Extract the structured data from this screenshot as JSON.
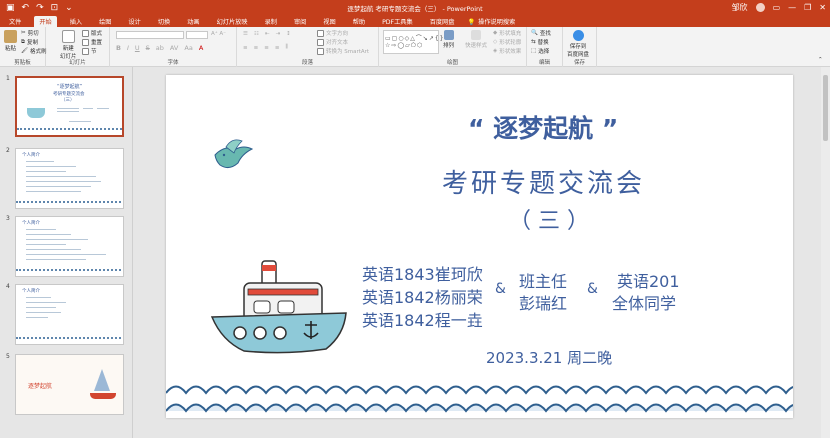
{
  "title_bar": {
    "title": "逐梦起航 考研专题交流会（三） - PowerPoint",
    "user_name": "邹欣",
    "undo": "↶",
    "redo": "↷",
    "present": "⊡",
    "minimize": "—",
    "restore": "❐",
    "close": "✕"
  },
  "tabs": [
    "文件",
    "开始",
    "插入",
    "绘图",
    "设计",
    "切换",
    "动画",
    "幻灯片放映",
    "录制",
    "审阅",
    "视图",
    "帮助",
    "PDF工具集",
    "百度网盘"
  ],
  "active_tab": "开始",
  "search_label": "操作说明搜索",
  "ribbon": {
    "clipboard": {
      "paste": "粘贴",
      "cut": "剪切",
      "copy": "复制",
      "format_painter": "格式刷",
      "label": "剪贴板"
    },
    "slides": {
      "new_slide": "新建\n幻灯片",
      "layout": "版式",
      "reset": "重置",
      "section": "节",
      "label": "幻灯片"
    },
    "font": {
      "bold": "B",
      "italic": "I",
      "underline": "U",
      "strike": "S",
      "shadow": "ab",
      "label": "字体"
    },
    "paragraph": {
      "text_direction": "文字方向",
      "align_text": "对齐文本",
      "smartart": "转换为 SmartArt",
      "label": "段落"
    },
    "drawing": {
      "arrange": "排列",
      "quick_styles": "快速样式",
      "fill": "形状填充",
      "outline": "形状轮廓",
      "effects": "形状效果",
      "label": "绘图"
    },
    "editing": {
      "find": "查找",
      "replace": "替换",
      "select": "选择",
      "label": "编辑"
    },
    "save": {
      "button": "保存到\n百度网盘",
      "label": "保存"
    }
  },
  "thumbnails": [
    {
      "num": "1",
      "title": "“逐梦起航”",
      "subtitle": "考研专题交流会",
      "part": "（三）"
    },
    {
      "num": "2",
      "title": "个人简介"
    },
    {
      "num": "3",
      "title": "个人简介"
    },
    {
      "num": "4",
      "title": "个人简介"
    },
    {
      "num": "5",
      "title": "逐梦起航"
    }
  ],
  "slide": {
    "title": "“ 逐梦起航 ”",
    "subtitle": "考研专题交流会",
    "part": "（ 三 ）",
    "speakers": [
      "英语1843崔珂欣",
      "英语1842杨丽荣",
      "英语1842程一垚"
    ],
    "amp": "&",
    "host_role": "班主任",
    "host_name": "彭瑞红",
    "audience_class": "英语201",
    "audience": "全体同学",
    "date": "2023.3.21 周二晚"
  },
  "colors": {
    "accent": "#c43e1c",
    "title_blue": "#3f5f9e",
    "boat_blue": "#8ec9d8",
    "wave_blue": "#2f5f8e",
    "bird": "#68b8b0"
  }
}
